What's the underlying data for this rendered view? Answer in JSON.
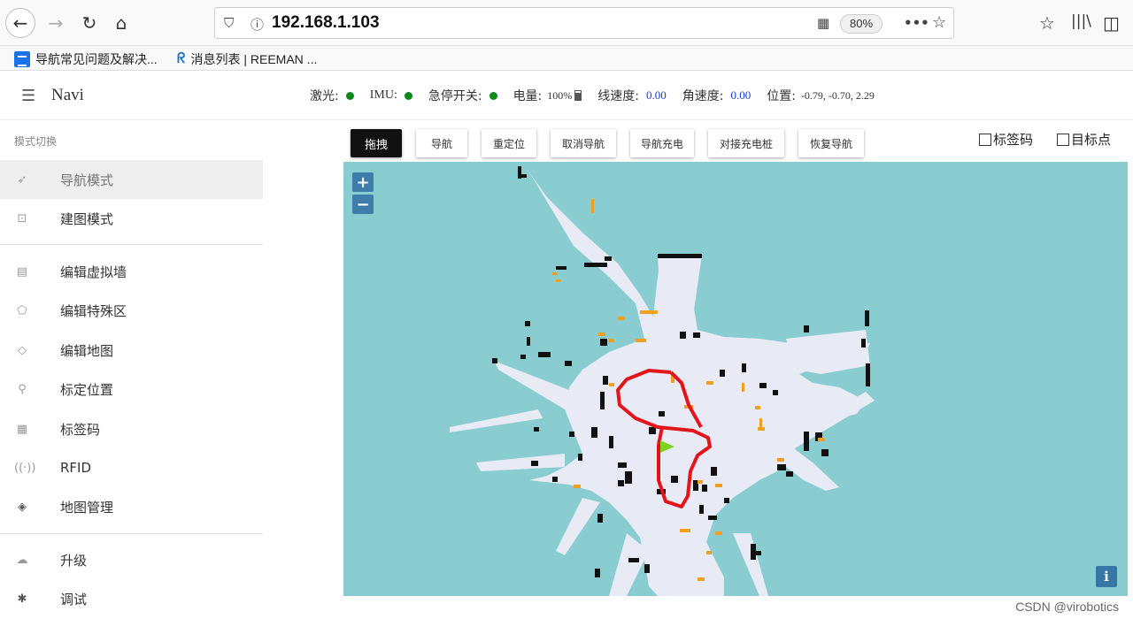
{
  "browser": {
    "url": "192.168.1.103",
    "zoom": "80%",
    "icons": [
      "back-icon",
      "forward-icon",
      "reload-icon",
      "home-icon",
      "shield-icon",
      "info-icon",
      "qr-icon",
      "more-icon",
      "star-icon",
      "pocket-icon",
      "library-icon",
      "sidebar-icon"
    ]
  },
  "bookmarks": [
    {
      "label": "导航常见问题及解决..."
    },
    {
      "label": "消息列表 | REEMAN ..."
    }
  ],
  "header": {
    "title": "Navi",
    "status": {
      "laser_label": "激光:",
      "imu_label": "IMU:",
      "estop_label": "急停开关:",
      "battery_label": "电量:",
      "battery_value": "100%",
      "linear_speed_label": "线速度:",
      "linear_speed_value": "0.00",
      "angular_speed_label": "角速度:",
      "angular_speed_value": "0.00",
      "position_label": "位置:",
      "position_value": "-0.79, -0.70, 2.29",
      "indicator_color": "#0a8a1a"
    }
  },
  "sidebar": {
    "heading": "模式切换",
    "items": [
      {
        "label": "导航模式",
        "icon": "navigation-arrow-icon",
        "active": true
      },
      {
        "label": "建图模式",
        "icon": "map-build-icon"
      },
      {
        "label": "编辑虚拟墙",
        "icon": "wall-icon"
      },
      {
        "label": "编辑特殊区",
        "icon": "pentagon-icon"
      },
      {
        "label": "编辑地图",
        "icon": "eraser-icon"
      },
      {
        "label": "标定位置",
        "icon": "location-icon"
      },
      {
        "label": "标签码",
        "icon": "qr-code-icon"
      },
      {
        "label": "RFID",
        "icon": "rfid-icon"
      },
      {
        "label": "地图管理",
        "icon": "layers-icon"
      },
      {
        "label": "升级",
        "icon": "cloud-upload-icon"
      },
      {
        "label": "调试",
        "icon": "bug-icon"
      }
    ]
  },
  "toolbar": {
    "buttons": [
      {
        "label": "拖拽",
        "primary": true
      },
      {
        "label": "导航"
      },
      {
        "label": "重定位"
      },
      {
        "label": "取消导航"
      },
      {
        "label": "导航充电"
      },
      {
        "label": "对接充电桩"
      },
      {
        "label": "恢复导航"
      }
    ],
    "checkboxes": [
      {
        "label": "标签码",
        "checked": false
      },
      {
        "label": "目标点",
        "checked": false
      }
    ]
  },
  "map": {
    "zoom_in": "+",
    "zoom_out": "−",
    "info": "i",
    "colors": {
      "background": "#89cdd1",
      "free_space": "#e8eaf6",
      "obstacle": "#111111",
      "marker": "#f0a020",
      "path": "#e3141a",
      "robot": "#7ed321"
    }
  },
  "watermark": "CSDN @virobotics"
}
